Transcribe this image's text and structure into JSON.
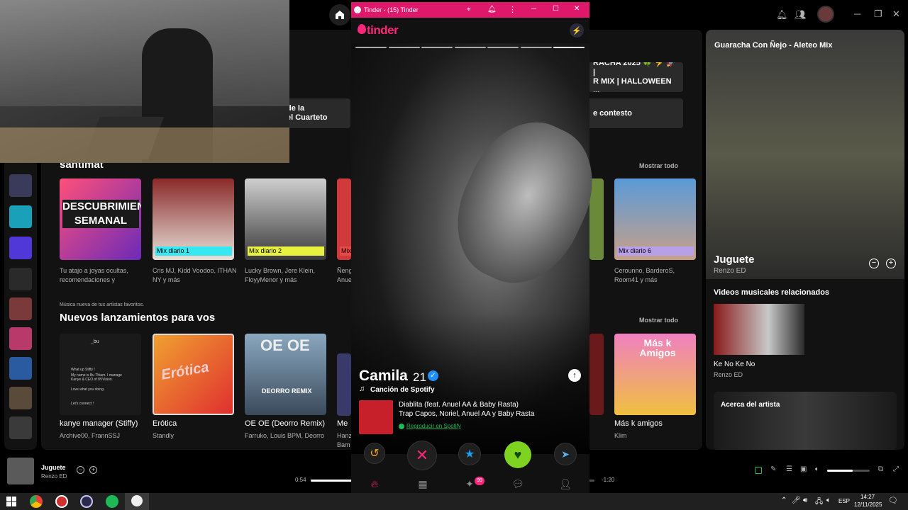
{
  "spotify": {
    "chips": [
      {
        "text": "de la\nel Cuarteto"
      },
      {
        "text": "RACHA 2025 🍀 ⚡ 🚀 |\nR MIX | HALLOWEEN ..."
      },
      {
        "text": "e contesto"
      }
    ],
    "section1": {
      "title": "santimat",
      "show_all": "Mostrar todo",
      "cards": [
        {
          "tag": "",
          "art_text": "DESCUBRIMIENTO SEMANAL",
          "sub": "Tu atajo a joyas ocultas, recomendaciones y"
        },
        {
          "tag": "Mix diario 1",
          "sub": "Cris MJ, Kidd Voodoo, ITHAN NY y más"
        },
        {
          "tag": "Mix diario 2",
          "sub": "Lucky Brown, Jere Klein, FloyyMenor y más"
        },
        {
          "tag": "Mix",
          "sub": "Ñeng Anue"
        },
        {
          "tag": "Mix diario 6",
          "sub": "Cerounno, BarderoS, Room41 y más"
        }
      ]
    },
    "section2": {
      "kicker": "Música nueva de tus artistas favoritos.",
      "title": "Nuevos lanzamientos para vos",
      "show_all": "Mostrar todo",
      "cards": [
        {
          "title": "kanye manager (Stiffy)",
          "sub": "Archive00, FrannSSJ"
        },
        {
          "title": "Erótica",
          "sub": "Standly"
        },
        {
          "title": "OE OE (Deorro Remix)",
          "sub": "Farruko, Louis BPM, Deorro"
        },
        {
          "title": "Me",
          "sub": "Hanz Bam"
        },
        {
          "title": "Más k amigos",
          "sub": "Klim"
        }
      ],
      "art_texts": {
        "kanye_handle": "_bu",
        "kanye_msg1": "What up Stiffy !",
        "kanye_msg2": "My name is Bu Thiam. I manage Kanye & CEO of 8VVision.",
        "kanye_msg3": "Love what you doing.",
        "kanye_msg4": "Let's connect !",
        "erotica": "Erótica",
        "oeoe": "OE OE",
        "deorro": "DEORRO REMIX",
        "masamigos": "Más k Amigos"
      }
    },
    "right_panel": {
      "title": "Guaracha Con Ñejo - Aleteo Mix",
      "song": "Juguete",
      "artist": "Renzo ED",
      "related_title": "Videos musicales relacionados",
      "related_song": "Ke No Ke No",
      "related_artist": "Renzo ED",
      "about_title": "Acerca del artista"
    },
    "player": {
      "song": "Juguete",
      "artist": "Renzo ED",
      "elapsed": "0:54",
      "remaining": "-1:20",
      "progress": 0.4,
      "volume": 0.6
    }
  },
  "tinder": {
    "window_title": "Tinder - (15) Tinder",
    "logo": "tinder",
    "name": "Camila",
    "age": "21",
    "spotify_label": "Canción de Spotify",
    "track_title": "Diablita (feat. Anuel AA & Baby Rasta)",
    "track_artists": "Trap Capos, Noriel, Anuel AA y Baby Rasta",
    "play_link": "Reproducir en Spotify",
    "chat_badge": "99",
    "colors": {
      "brand": "#fd267a",
      "titlebar": "#e0186c"
    }
  },
  "taskbar": {
    "lang": "ESP",
    "time": "14:27",
    "date": "12/11/2025"
  }
}
